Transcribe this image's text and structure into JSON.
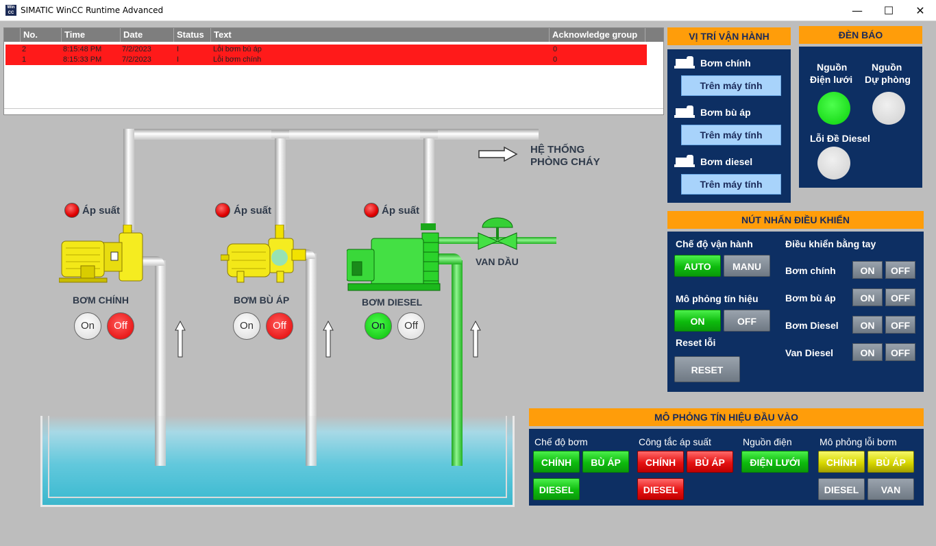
{
  "window": {
    "title": "SIMATIC WinCC Runtime Advanced",
    "icon_text": "Win CC",
    "min_glyph": "—",
    "max_glyph": "☐",
    "close_glyph": "✕"
  },
  "alarm_view": {
    "columns": [
      "No.",
      "Time",
      "Date",
      "Status",
      "Text",
      "Acknowledge group"
    ],
    "rows": [
      {
        "no": "2",
        "time": "8:15:48 PM",
        "date": "7/2/2023",
        "status": "I",
        "text": "Lỗi bơm bù áp",
        "ack": "0"
      },
      {
        "no": "1",
        "time": "8:15:33 PM",
        "date": "7/2/2023",
        "status": "I",
        "text": "Lỗi bơm chính",
        "ack": "0"
      }
    ],
    "row_color": "#ff1a1a"
  },
  "process": {
    "system_label_line1": "HỆ THỐNG",
    "system_label_line2": "PHÒNG CHÁY",
    "valve_label": "VAN DẦU",
    "pressure_label": "Áp suất",
    "pumps": [
      {
        "name": "BƠM CHÍNH",
        "on_label": "On",
        "off_label": "Off",
        "state": "off"
      },
      {
        "name": "BƠM BÙ ÁP",
        "on_label": "On",
        "off_label": "Off",
        "state": "off"
      },
      {
        "name": "BƠM DIESEL",
        "on_label": "On",
        "off_label": "Off",
        "state": "on"
      }
    ]
  },
  "operating_position": {
    "title": "VỊ TRÍ VẬN HÀNH",
    "items": [
      {
        "label": "Bơm chính",
        "button": "Trên máy tính"
      },
      {
        "label": "Bơm bù áp",
        "button": "Trên máy tính"
      },
      {
        "label": "Bơm diesel",
        "button": "Trên máy tính"
      }
    ]
  },
  "indicator_lights": {
    "title": "ĐÈN BÁO",
    "grid_line1": "Nguồn",
    "grid_line2": "Điện lưới",
    "backup_line1": "Nguồn",
    "backup_line2": "Dự phòng",
    "diesel_fault": "Lỗi Đề Diesel",
    "grid_state": "on",
    "backup_state": "off",
    "diesel_fault_state": "off"
  },
  "control_buttons": {
    "title": "NÚT NHẤN ĐIỀU KHIỂN",
    "mode_label": "Chế độ vận hành",
    "auto_label": "AUTO",
    "manu_label": "MANU",
    "sim_label": "Mô phỏng tín hiệu",
    "sim_on": "ON",
    "sim_off": "OFF",
    "reset_label": "Reset lỗi",
    "reset_button": "RESET",
    "manual_label": "Điều khiển bằng tay",
    "manual_items": [
      {
        "label": "Bơm chính",
        "on": "ON",
        "off": "OFF"
      },
      {
        "label": "Bơm bù áp",
        "on": "ON",
        "off": "OFF"
      },
      {
        "label": "Bơm Diesel",
        "on": "ON",
        "off": "OFF"
      },
      {
        "label": "Van Diesel",
        "on": "ON",
        "off": "OFF"
      }
    ]
  },
  "input_sim": {
    "title": "MÔ PHỎNG TÍN HIỆU ĐẦU VÀO",
    "pump_mode_label": "Chế độ bơm",
    "pressure_switch_label": "Công tắc áp suất",
    "power_label": "Nguồn điện",
    "fault_sim_label": "Mô phỏng lỗi bơm",
    "pm_main": "CHÍNH",
    "pm_jockey": "BÙ ÁP",
    "pm_diesel": "DIESEL",
    "ps_main": "CHÍNH",
    "ps_jockey": "BÙ ÁP",
    "ps_diesel": "DIESEL",
    "power_grid": "ĐIỆN LƯỚI",
    "fs_main": "CHÍNH",
    "fs_jockey": "BÙ ÁP",
    "fs_diesel": "DIESEL",
    "fs_valve": "VAN"
  }
}
